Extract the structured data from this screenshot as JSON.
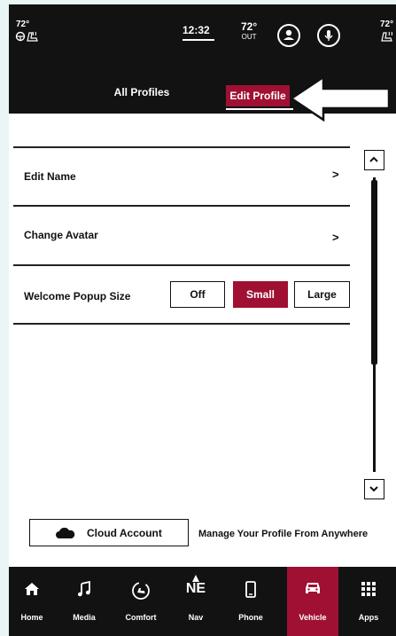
{
  "status_bar": {
    "left_temp": "72°",
    "clock": "12:32",
    "outside_temp": "72°",
    "outside_label": "OUT",
    "right_temp": "72°"
  },
  "tabs": {
    "all_profiles": "All Profiles",
    "edit_profile": "Edit Profile"
  },
  "list": {
    "edit_name": "Edit Name",
    "change_avatar": "Change Avatar",
    "welcome_popup_size": "Welcome Popup Size",
    "popup_options": [
      "Off",
      "Small",
      "Large"
    ],
    "popup_selected": "Small"
  },
  "cloud": {
    "button_label": "Cloud Account",
    "description": "Manage Your Profile From Anywhere"
  },
  "nav": {
    "items": [
      {
        "label": "Home",
        "icon": "home-icon"
      },
      {
        "label": "Media",
        "icon": "music-note-icon"
      },
      {
        "label": "Comfort",
        "icon": "comfort-icon"
      },
      {
        "label": "Nav",
        "icon": "compass-icon",
        "heading": "NE"
      },
      {
        "label": "Phone",
        "icon": "phone-icon"
      },
      {
        "label": "Vehicle",
        "icon": "car-icon"
      },
      {
        "label": "Apps",
        "icon": "apps-grid-icon"
      }
    ],
    "active": "Vehicle"
  },
  "colors": {
    "accent": "#a01033",
    "bar_background": "#121212"
  }
}
